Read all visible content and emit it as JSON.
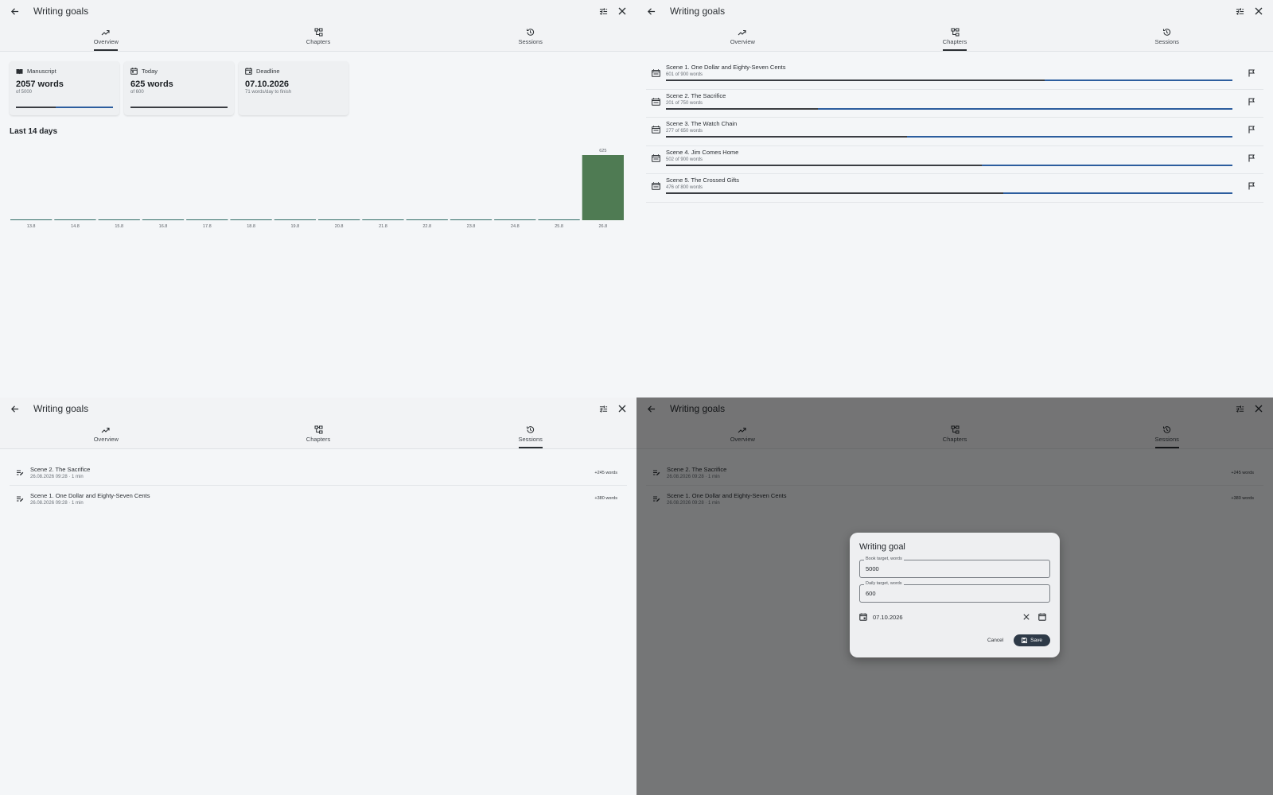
{
  "app": {
    "title": "Writing goals",
    "tabs": [
      "Overview",
      "Chapters",
      "Sessions"
    ]
  },
  "overview": {
    "cards": [
      {
        "label": "Manuscript",
        "value": "2057 words",
        "sub": "of 5000",
        "progress": 0.41,
        "icon": "book-icon"
      },
      {
        "label": "Today",
        "value": "625 words",
        "sub": "of 600",
        "progress": 1.0,
        "icon": "calendar-today-icon"
      },
      {
        "label": "Deadline",
        "value": "07.10.2026",
        "sub": "71 words/day to finish",
        "icon": "calendar-event-icon"
      }
    ],
    "section_title": "Last 14 days"
  },
  "chart_data": {
    "type": "bar",
    "categories": [
      "13.8",
      "14.8",
      "15.8",
      "16.8",
      "17.8",
      "18.8",
      "19.8",
      "20.8",
      "21.8",
      "22.8",
      "23.8",
      "24.8",
      "25.8",
      "26.8"
    ],
    "values": [
      0,
      0,
      0,
      0,
      0,
      0,
      0,
      0,
      0,
      0,
      0,
      0,
      0,
      625
    ],
    "data_labels": [
      "",
      "",
      "",
      "",
      "",
      "",
      "",
      "",
      "",
      "",
      "",
      "",
      "",
      "625"
    ],
    "title": "Last 14 days",
    "xlabel": "",
    "ylabel": "",
    "ylim": [
      0,
      625
    ],
    "grid": false,
    "colors": {
      "bar": "#4f7b53",
      "zero_line": "#2f6b66"
    }
  },
  "chapters": [
    {
      "name": "Scene 1. One Dollar and Eighty-Seven Cents",
      "sub": "601 of 900 words",
      "progress": 0.668
    },
    {
      "name": "Scene 2. The Sacrifice",
      "sub": "201 of 750 words",
      "progress": 0.268
    },
    {
      "name": "Scene 3. The Watch Chain",
      "sub": "277 of 650 words",
      "progress": 0.426
    },
    {
      "name": "Scene 4. Jim Comes Home",
      "sub": "502 of 900 words",
      "progress": 0.558
    },
    {
      "name": "Scene 5. The Crossed Gifts",
      "sub": "476 of 800 words",
      "progress": 0.595
    }
  ],
  "sessions": [
    {
      "name": "Scene 2. The Sacrifice",
      "sub": "26.08.2026 09:28 · 1 min",
      "delta": "+245 words"
    },
    {
      "name": "Scene 1. One Dollar and Eighty-Seven Cents",
      "sub": "26.08.2026 09:28 · 1 min",
      "delta": "+380 words"
    }
  ],
  "dialog": {
    "title": "Writing goal",
    "book_label": "Book target, words",
    "book_value": "5000",
    "daily_label": "Daily target, words",
    "daily_value": "600",
    "deadline_value": "07.10.2026",
    "cancel_label": "Cancel",
    "save_label": "Save"
  },
  "colors": {
    "accent": "#2c5d9e",
    "progress_fill": "#3a3d42",
    "save_button": "#2e3a48"
  }
}
